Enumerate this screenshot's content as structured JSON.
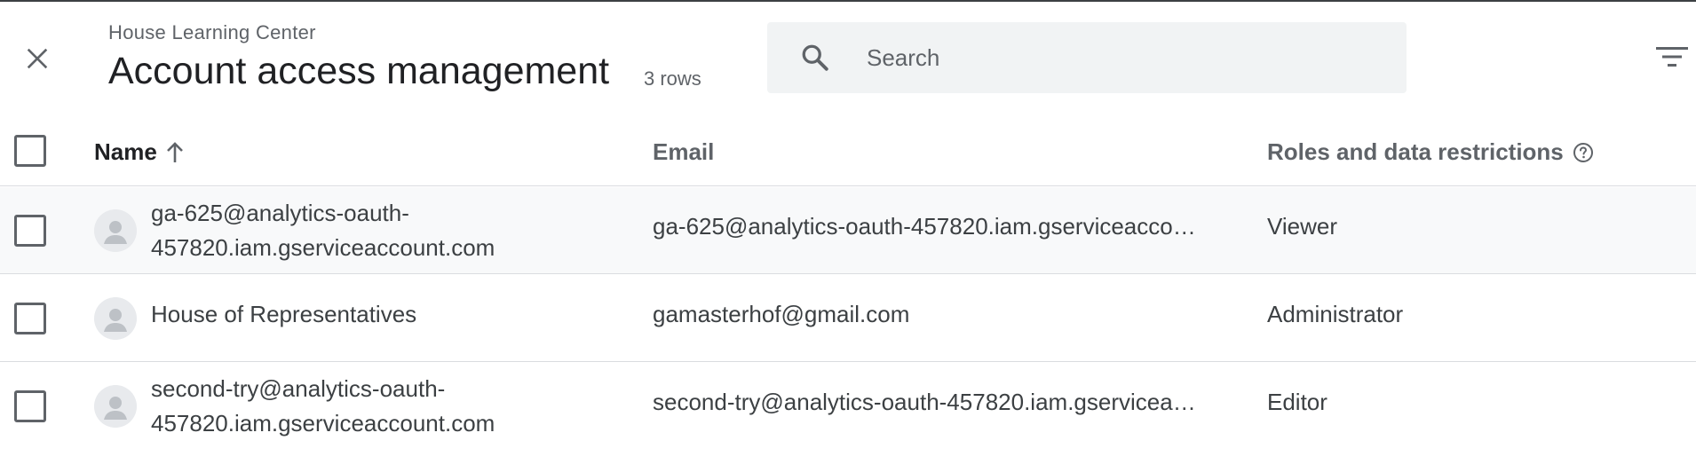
{
  "header": {
    "subtitle": "House Learning Center",
    "title": "Account access management",
    "row_count": "3 rows"
  },
  "search": {
    "placeholder": "Search",
    "value": ""
  },
  "table": {
    "columns": {
      "name": "Name",
      "email": "Email",
      "roles": "Roles and data restrictions"
    },
    "sort": {
      "column": "name",
      "direction": "ascending"
    },
    "rows": [
      {
        "name": "ga-625@analytics-oauth-457820.iam.gserviceaccount.com",
        "email": "ga-625@analytics-oauth-457820.iam.gserviceaccount.com",
        "role": "Viewer",
        "checked": false
      },
      {
        "name": "House of Representatives",
        "email": "gamasterhof@gmail.com",
        "role": "Administrator",
        "checked": false
      },
      {
        "name": "second-try@analytics-oauth-457820.iam.gserviceaccount.com",
        "email": "second-try@analytics-oauth-457820.iam.gserviceaccount.com",
        "role": "Editor",
        "checked": false
      }
    ]
  },
  "icons": {
    "close": "close-icon",
    "search": "search-icon",
    "filter": "filter-icon",
    "sort": "arrow-up-icon",
    "help": "help-circle-icon",
    "avatar": "person-avatar-icon"
  },
  "colors": {
    "text_primary": "#202124",
    "text_secondary": "#5f6368",
    "search_bg": "#f1f3f4",
    "row_hover": "#f8f9fa",
    "divider": "#dadce0"
  }
}
